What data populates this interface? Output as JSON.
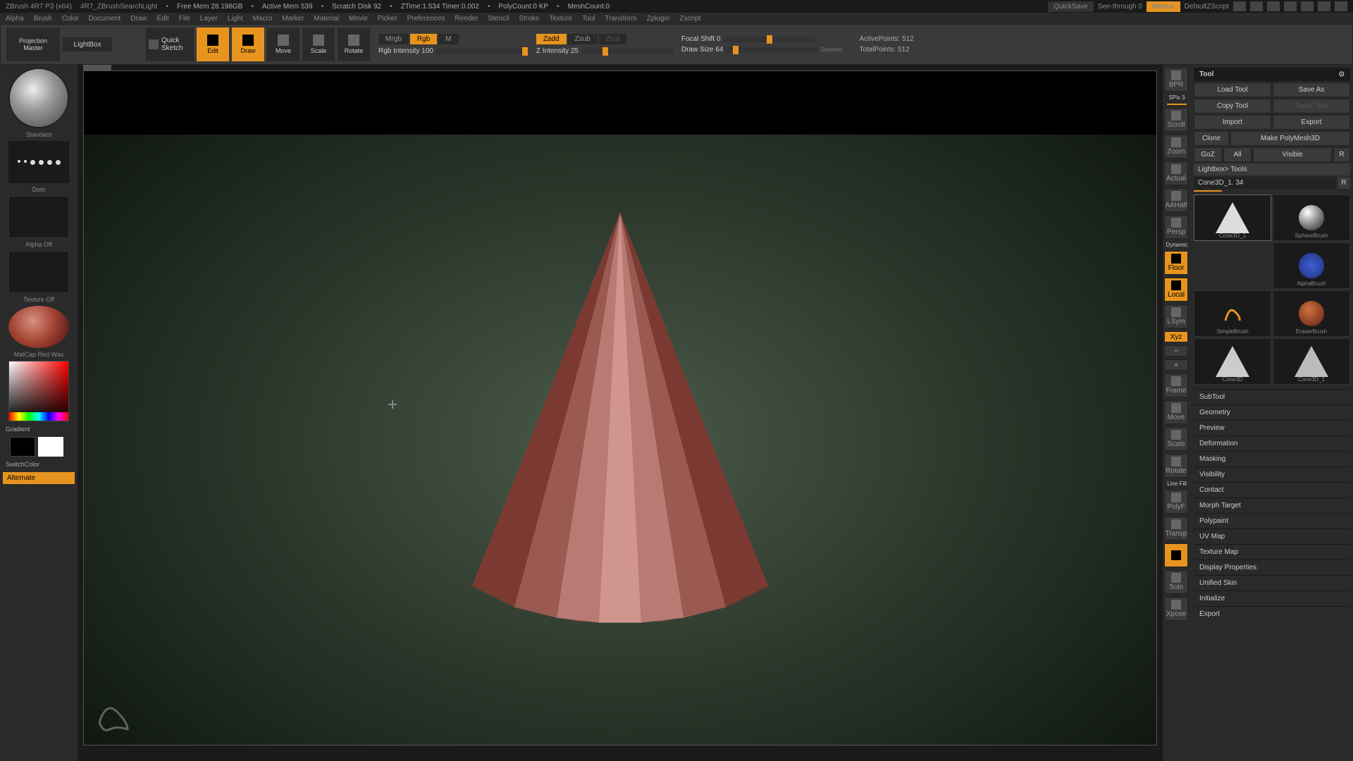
{
  "titlebar": {
    "app": "ZBrush 4R7 P3 (x64)",
    "doc": "4R7_ZBrushSearchLight",
    "freemem": "Free Mem 28.198GB",
    "activemem": "Active Mem 539",
    "scratch": "Scratch Disk 92",
    "ztime": "ZTime:1.534 Timer:0.002",
    "polycount": "PolyCount:0 KP",
    "meshcount": "MeshCount:0",
    "quicksave": "QuickSave",
    "seethrough": "See-through  0",
    "menus": "Menus",
    "script": "DefaultZScript"
  },
  "menubar": [
    "Alpha",
    "Brush",
    "Color",
    "Document",
    "Draw",
    "Edit",
    "File",
    "Layer",
    "Light",
    "Macro",
    "Marker",
    "Material",
    "Movie",
    "Picker",
    "Preferences",
    "Render",
    "Stencil",
    "Stroke",
    "Texture",
    "Tool",
    "Transform",
    "Zplugin",
    "Zscript"
  ],
  "toolbar": {
    "projection1": "Projection",
    "projection2": "Master",
    "lightbox": "LightBox",
    "quicksketch1": "Quick",
    "quicksketch2": "Sketch",
    "edit": "Edit",
    "draw": "Draw",
    "move": "Move",
    "scale": "Scale",
    "rotate": "Rotate",
    "mrgb": "Mrgb",
    "rgb": "Rgb",
    "m": "M",
    "rgb_intensity": "Rgb Intensity 100",
    "zadd": "Zadd",
    "zsub": "Zsub",
    "zcut": "Zcut",
    "z_intensity": "Z Intensity 25",
    "focal_shift": "Focal Shift 0",
    "draw_size": "Draw Size 64",
    "dynamic": "Dynamic",
    "active_points": "ActivePoints: 512",
    "total_points": "TotalPoints: 512"
  },
  "left": {
    "brush": "Standard",
    "stroke": "Dots",
    "alpha": "Alpha Off",
    "texture": "Texture Off",
    "material": "MatCap Red Wax",
    "gradient": "Gradient",
    "switchcolor": "SwitchColor",
    "alternate": "Alternate"
  },
  "sidebtns": {
    "bpr": "BPR",
    "spix": "SPix 3",
    "scroll": "Scroll",
    "zoom": "Zoom",
    "actual": "Actual",
    "aahalf": "AAHalf",
    "persp": "Persp",
    "dyn": "Dynamic",
    "floor": "Floor",
    "local": "Local",
    "lsym": "LSym",
    "xyz": "Xyz",
    "frame": "Frame",
    "move": "Move",
    "scale": "Scale",
    "rotate": "Rotate",
    "linefill": "Line Fill",
    "polyf": "PolyF",
    "transp": "Transp",
    "ghost": "",
    "solo": "Solo",
    "xpose": "Xpose"
  },
  "tool": {
    "header": "Tool",
    "load": "Load Tool",
    "saveas": "Save As",
    "copy": "Copy Tool",
    "paste": "Paste Tool",
    "import": "Import",
    "export_btn": "Export",
    "clone": "Clone",
    "makepoly": "Make PolyMesh3D",
    "goz": "GoZ",
    "all": "All",
    "visible": "Visible",
    "r": "R",
    "lightbox_tools": "Lightbox> Tools",
    "toolname": "Cone3D_1. 34",
    "thumbs": [
      "Cone3D_1",
      "SphereBrush",
      "AlphaBrush",
      "SimpleBrush",
      "EraserBrush",
      "Cone3D",
      "Cone3D_1"
    ],
    "sections": [
      "SubTool",
      "Geometry",
      "Preview",
      "Deformation",
      "Masking",
      "Visibility",
      "Contact",
      "Morph Target",
      "Polypaint",
      "UV Map",
      "Texture Map",
      "Display Properties",
      "Unified Skin",
      "Initialize",
      "Export"
    ]
  }
}
